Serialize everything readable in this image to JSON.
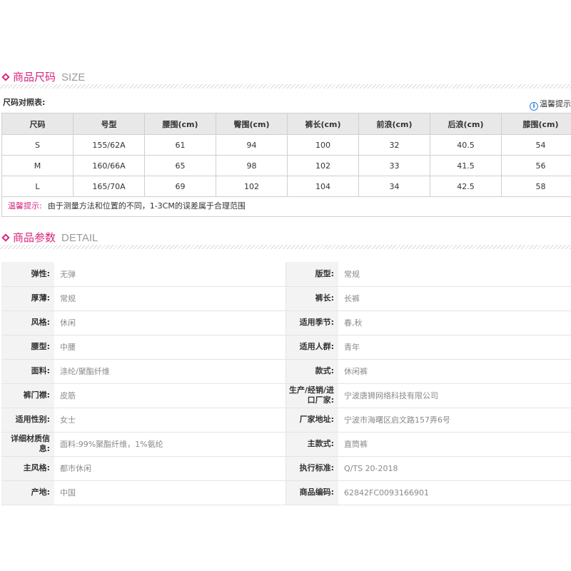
{
  "size_section": {
    "title_cn": "商品尺码",
    "title_en": "SIZE"
  },
  "size_chart": {
    "label": "尺码对照表:",
    "tip_link": "温馨提示",
    "headers": [
      "尺码",
      "号型",
      "腰围(cm)",
      "臀围(cm)",
      "裤长(cm)",
      "前浪(cm)",
      "后浪(cm)",
      "膝围(cm)"
    ],
    "rows": [
      [
        "S",
        "155/62A",
        "61",
        "94",
        "100",
        "32",
        "40.5",
        "54"
      ],
      [
        "M",
        "160/66A",
        "65",
        "98",
        "102",
        "33",
        "41.5",
        "56"
      ],
      [
        "L",
        "165/70A",
        "69",
        "102",
        "104",
        "34",
        "42.5",
        "58"
      ]
    ],
    "note_label": "温馨提示:",
    "note_text": "由于测量方法和位置的不同，1-3CM的误差属于合理范围"
  },
  "detail_section": {
    "title_cn": "商品参数",
    "title_en": "DETAIL"
  },
  "details": [
    {
      "k1": "弹性:",
      "v1": "无弹",
      "k2": "版型:",
      "v2": "常规"
    },
    {
      "k1": "厚薄:",
      "v1": "常规",
      "k2": "裤长:",
      "v2": "长裤"
    },
    {
      "k1": "风格:",
      "v1": "休闲",
      "k2": "适用季节:",
      "v2": "春,秋"
    },
    {
      "k1": "腰型:",
      "v1": "中腰",
      "k2": "适用人群:",
      "v2": "青年"
    },
    {
      "k1": "面料:",
      "v1": "涤纶/聚酯纤维",
      "k2": "款式:",
      "v2": "休闲裤"
    },
    {
      "k1": "裤门襟:",
      "v1": "皮筋",
      "k2": "生产/经销/进口厂家:",
      "v2": "宁波唐狮网络科技有限公司"
    },
    {
      "k1": "适用性别:",
      "v1": "女士",
      "k2": "厂家地址:",
      "v2": "宁波市海曙区启文路157弄6号"
    },
    {
      "k1": "详细材质信息:",
      "v1": "面料:99%聚酯纤维，1%氨纶",
      "k2": "主款式:",
      "v2": "直筒裤"
    },
    {
      "k1": "主风格:",
      "v1": "都市休闲",
      "k2": "执行标准:",
      "v2": "Q/TS 20-2018"
    },
    {
      "k1": "产地:",
      "v1": "中国",
      "k2": "商品编码:",
      "v2": "62842FC0093166901"
    }
  ],
  "colors": {
    "accent": "#d6267f",
    "header_bg": "#e8e8e8",
    "key_bg": "#f3f3f3",
    "muted_text": "#8a8a8a"
  }
}
